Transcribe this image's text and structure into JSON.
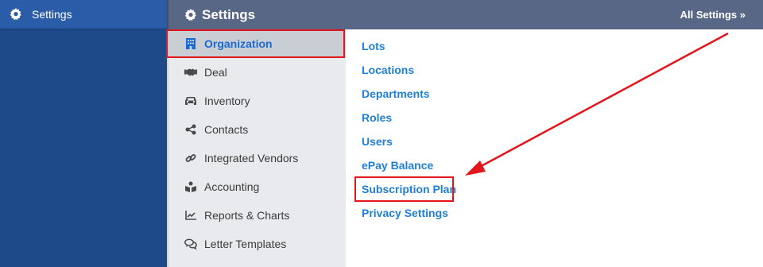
{
  "app_sidebar": {
    "title": "Settings",
    "icon": "gear-icon"
  },
  "topbar": {
    "title": "Settings",
    "icon": "gear-icon",
    "all_settings_label": "All Settings »"
  },
  "categories": [
    {
      "label": "Organization",
      "icon": "building-icon",
      "active": true
    },
    {
      "label": "Deal",
      "icon": "handshake-icon",
      "active": false
    },
    {
      "label": "Inventory",
      "icon": "car-icon",
      "active": false
    },
    {
      "label": "Contacts",
      "icon": "share-icon",
      "active": false
    },
    {
      "label": "Integrated Vendors",
      "icon": "link-icon",
      "active": false
    },
    {
      "label": "Accounting",
      "icon": "book-reader-icon",
      "active": false
    },
    {
      "label": "Reports & Charts",
      "icon": "chart-line-icon",
      "active": false
    },
    {
      "label": "Letter Templates",
      "icon": "comments-icon",
      "active": false
    }
  ],
  "links": [
    {
      "label": "Lots"
    },
    {
      "label": "Locations"
    },
    {
      "label": "Departments"
    },
    {
      "label": "Roles"
    },
    {
      "label": "Users"
    },
    {
      "label": "ePay Balance"
    },
    {
      "label": "Subscription Plan",
      "highlighted": true
    },
    {
      "label": "Privacy Settings"
    }
  ],
  "colors": {
    "sidebar_bg": "#1e4a8a",
    "topbar_bg": "#596786",
    "active_text": "#1a6ad4",
    "link_text": "#1f7fd6",
    "annotation_red": "#e3161d"
  }
}
